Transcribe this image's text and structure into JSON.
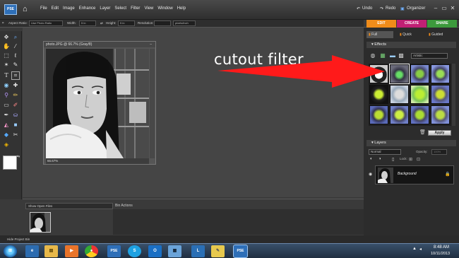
{
  "app": {
    "logo_label": "PSE"
  },
  "menu": [
    "File",
    "Edit",
    "Image",
    "Enhance",
    "Layer",
    "Select",
    "Filter",
    "View",
    "Window",
    "Help"
  ],
  "titlebar": {
    "undo": "Undo",
    "redo": "Redo",
    "organizer": "Organizer",
    "minimize": "–",
    "restore": "▭",
    "close": "✕"
  },
  "modes": {
    "edit": "EDIT",
    "create": "CREATE",
    "share": "SHARE"
  },
  "options": {
    "aspect_label": "Aspect Ratio:",
    "aspect_value": "Use Photo Ratio",
    "width_label": "Width:",
    "width_value": "5 in",
    "height_label": "Height:",
    "height_value": "5 in",
    "resolution_label": "Resolution:",
    "resolution_unit": "pixels/inch"
  },
  "document": {
    "title": "photo.JPG @ 66.7% (Gray/8)",
    "zoom": "66.67%",
    "minimize": "–"
  },
  "bin": {
    "show_label": "Show Open Files",
    "actions_label": "Bin Actions",
    "hide_label": "Hide Project Bin"
  },
  "panel": {
    "tabs": {
      "full": "Full",
      "quick": "Quick",
      "guided": "Guided"
    },
    "effects_title": "Effects",
    "effects_category": "Artistic",
    "apply_label": "Apply",
    "layers_title": "Layers",
    "blend_mode": "Normal",
    "opacity_label": "Opacity:",
    "opacity_value": "100%",
    "lock_label": "Lock:",
    "layer_name": "Background"
  },
  "annotation": {
    "text": "cutout filter",
    "arrow_color": "#ff1a1a"
  },
  "taskbar": {
    "time": "8:48 AM",
    "date": "10/11/2013",
    "apps": [
      "explorer",
      "media-player",
      "chrome",
      "photoshop-elements",
      "skype",
      "outlook",
      "lync",
      "sticky-notes",
      "photoshop-elements-2"
    ]
  },
  "colors": {
    "edit_tab": "#f08c1a",
    "create_tab": "#c01f74",
    "share_tab": "#3c9a3c",
    "accent": "#f08c1a"
  }
}
